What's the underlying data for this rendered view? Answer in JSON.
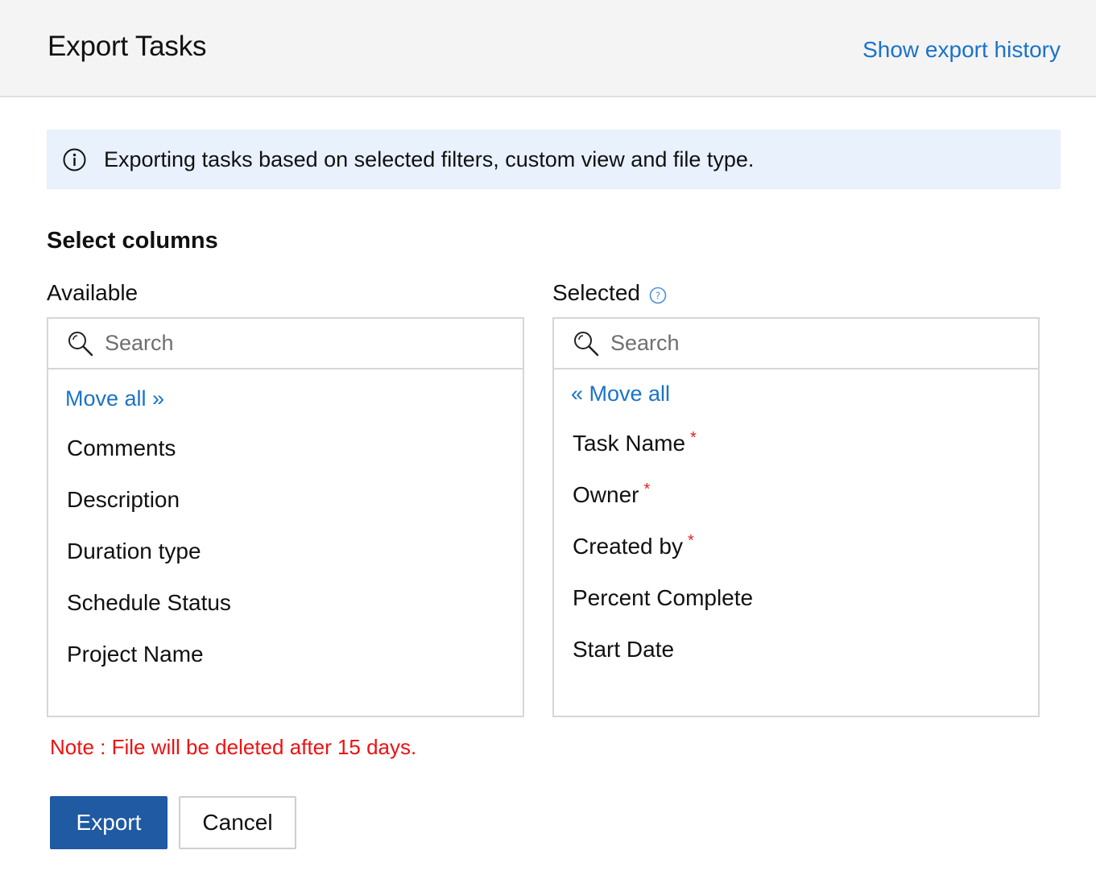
{
  "header": {
    "title": "Export Tasks",
    "history_link": "Show export history"
  },
  "info_banner": {
    "icon": "info-circle-icon",
    "text": "Exporting tasks based on selected filters, custom view and file type."
  },
  "section_title": "Select columns",
  "available": {
    "label": "Available",
    "search_placeholder": "Search",
    "move_all": "Move all »",
    "items": [
      "Comments",
      "Description",
      "Duration type",
      "Schedule Status",
      "Project Name"
    ]
  },
  "selected": {
    "label": "Selected",
    "help_icon": "question-circle-icon",
    "search_placeholder": "Search",
    "move_all": "« Move all",
    "items": [
      {
        "label": "Task Name",
        "required": "*"
      },
      {
        "label": "Owner",
        "required": "*"
      },
      {
        "label": "Created by",
        "required": "*"
      },
      {
        "label": "Percent Complete",
        "required": ""
      },
      {
        "label": "Start Date",
        "required": ""
      }
    ]
  },
  "note": "Note : File will be deleted after 15 days.",
  "buttons": {
    "export": "Export",
    "cancel": "Cancel"
  },
  "colors": {
    "link": "#1a73c8",
    "primary_button": "#1f5aa2",
    "note": "#ee1111",
    "banner_bg": "#e8f1fc",
    "header_bg": "#f4f4f4"
  }
}
